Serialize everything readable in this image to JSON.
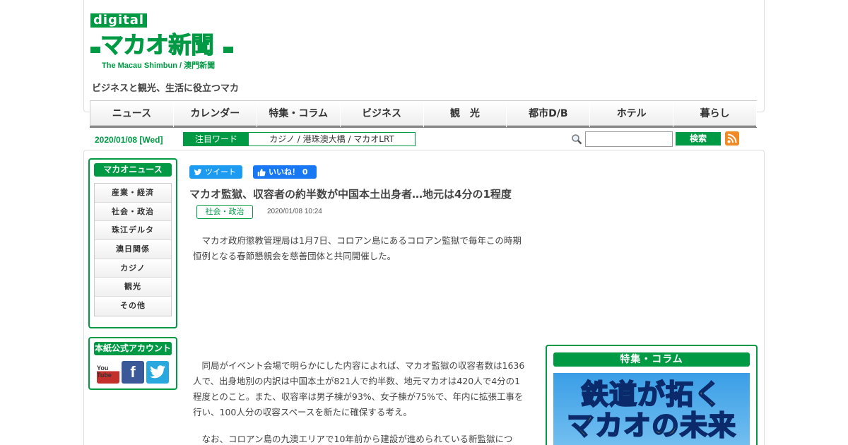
{
  "header": {
    "logo_digital": "digital",
    "logo_main": "マカオ新聞",
    "logo_sub": "The Macau Shimbun / 澳門新聞",
    "tagline": "ビジネスと観光、生活に役立つマカ"
  },
  "nav": {
    "items": [
      "ニュース",
      "カレンダー",
      "特集・コラム",
      "ビジネス",
      "観　光",
      "都市D/B",
      "ホテル",
      "暮らし"
    ]
  },
  "toolbar": {
    "date": "2020/01/08 [Wed]",
    "keyword_label": "注目ワード",
    "keywords": "カジノ / 港珠澳大橋 / マカオLRT",
    "search_value": "",
    "search_button": "検索"
  },
  "sidebar": {
    "news_title": "マカオニュース",
    "categories": [
      "産業・経済",
      "社会・政治",
      "珠江デルタ",
      "澳日関係",
      "カジノ",
      "観光",
      "その他"
    ],
    "official_title": "本紙公式アカウント",
    "social": [
      "You Tube",
      "f",
      "twitter"
    ]
  },
  "article": {
    "tweet_label": "ツイート",
    "like_label": "いいね！ 0",
    "title": "マカオ監獄、収容者の約半数が中国本土出身者…地元は4分の1程度",
    "category": "社会・政治",
    "published": "2020/01/08 10:24",
    "para1": "　マカオ政府懲教管理局は1月7日、コロアン島にあるコロアン監獄で毎年この時期恒例となる春節懇親会を慈善団体と共同開催した。",
    "para2": "　同局がイベント会場で明らかにした内容によれば、マカオ監獄の収容者数は1636人で、出身地別の内訳は中国本土が821人で約半数、地元マカオは420人で4分の1程度とのこと。また、収容率は男子棟が93%、女子棟が75%で、年内に拡張工事を行い、100人分の収容スペースを新たに確保する考え。",
    "para3": "　なお、コロアン島の九澳エリアで10年前から建設が進められている新監獄につ"
  },
  "feature": {
    "title": "特集・コラム",
    "banner_line1": "鉄道が拓く",
    "banner_line2": "マカオの未来"
  },
  "colors": {
    "brand_green": "#009944",
    "twitter_blue": "#1d9bf0",
    "facebook_blue": "#1877f2",
    "rss_orange": "#f08a24"
  }
}
